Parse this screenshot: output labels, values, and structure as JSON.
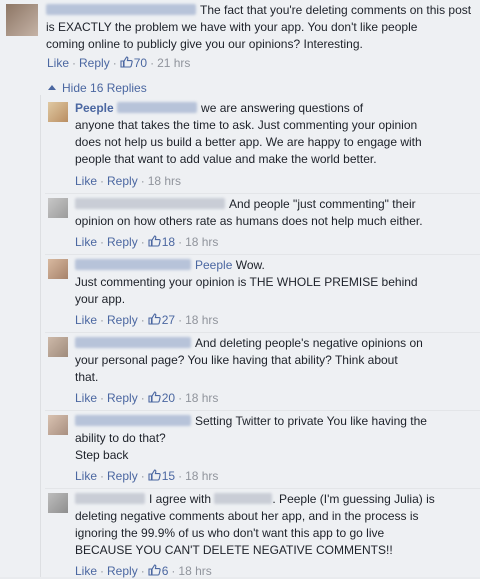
{
  "top_comment": {
    "text_line1": "The fact that you're deleting comments on this post",
    "text_line2": "is EXACTLY the problem we have with your app. You don't like people",
    "text_line3": "coming online to publicly give you our opinions? Interesting.",
    "like": "Like",
    "reply": "Reply",
    "likes": "70",
    "time": "21 hrs"
  },
  "replies_toggle": "Hide 16 Replies",
  "replies": [
    {
      "author": "Peeple",
      "lines": [
        "we are answering questions of",
        "anyone that takes the time to ask. Just commenting your opinion",
        "does not help us build a better app. We are happy to engage with",
        "people that want to add value and make the world better."
      ],
      "like": "Like",
      "reply": "Reply",
      "likes": "",
      "time": "18 hrs"
    },
    {
      "author": "",
      "lines": [
        "And people \"just commenting\" their",
        "opinion on how others rate as humans does not help much either."
      ],
      "like": "Like",
      "reply": "Reply",
      "likes": "18",
      "time": "18 hrs"
    },
    {
      "author": "Peeple",
      "lines": [
        "Wow.",
        "Just commenting your opinion is THE WHOLE PREMISE behind",
        "your app."
      ],
      "like": "Like",
      "reply": "Reply",
      "likes": "27",
      "time": "18 hrs"
    },
    {
      "author": "",
      "lines": [
        "And deleting people's negative opinions on",
        "your personal page? You like having that ability? Think about",
        "that."
      ],
      "like": "Like",
      "reply": "Reply",
      "likes": "20",
      "time": "18 hrs"
    },
    {
      "author": "",
      "lines": [
        "Setting Twitter to private You like having the",
        "ability to do that?",
        "Step back"
      ],
      "like": "Like",
      "reply": "Reply",
      "likes": "15",
      "time": "18 hrs"
    },
    {
      "author": "",
      "lines": [
        "I agree with",
        ". Peeple (I'm guessing Julia) is",
        "deleting negative comments about her app, and in the process is",
        "ignoring the 99.9% of us who don't want this app to go live",
        "BECAUSE YOU CAN'T DELETE NEGATIVE COMMENTS!!"
      ],
      "like": "Like",
      "reply": "Reply",
      "likes": "6",
      "time": "18 hrs"
    }
  ],
  "icons": {
    "like_icon": "thumbs-up-icon",
    "toggle_icon": "caret-up-icon"
  },
  "colors": {
    "link": "#4b67a1",
    "meta": "#90949c",
    "text": "#1d2129"
  }
}
